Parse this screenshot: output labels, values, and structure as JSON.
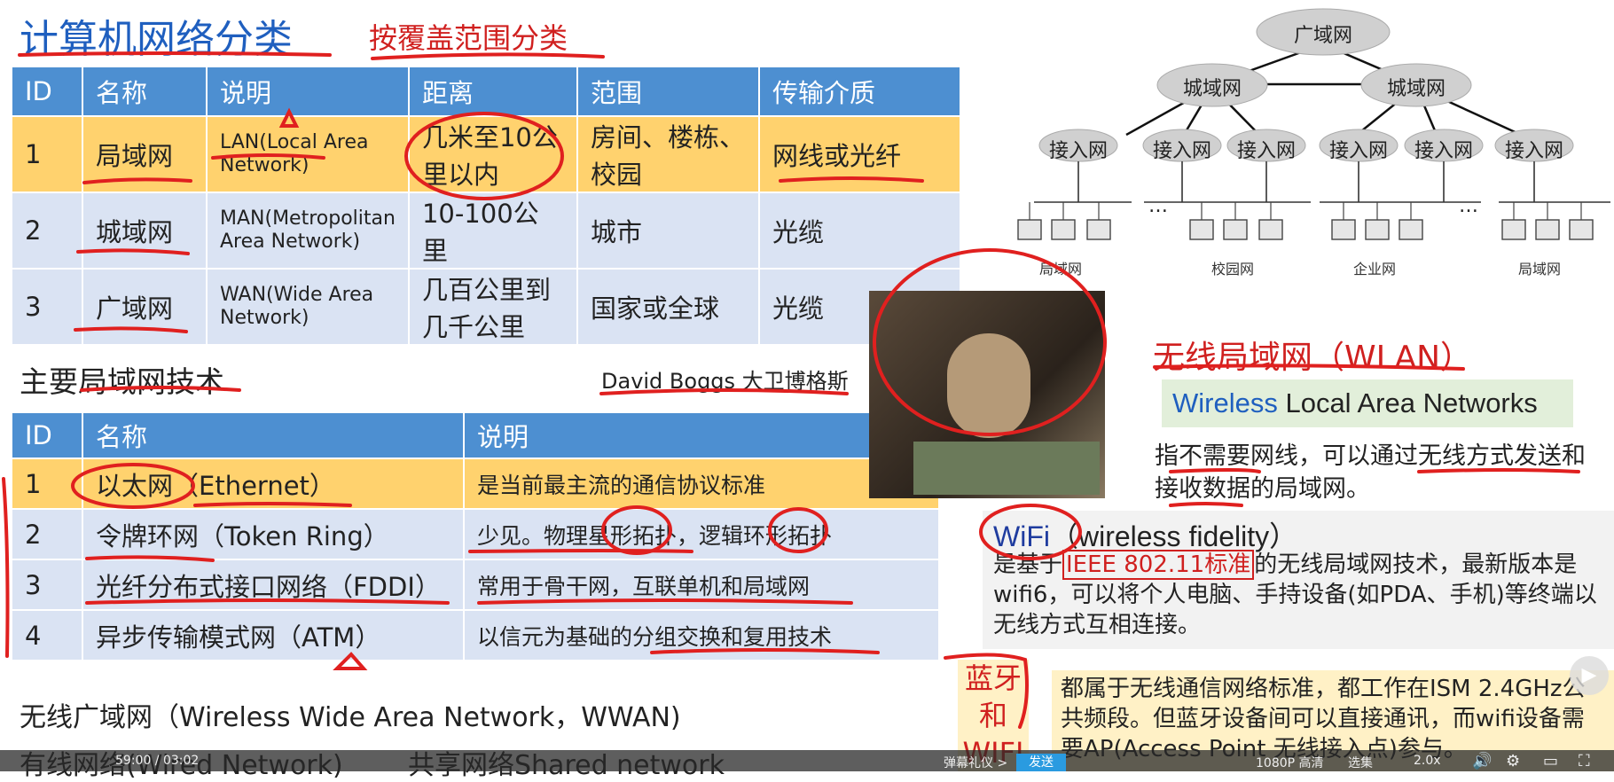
{
  "header": {
    "title": "计算机网络分类",
    "subtitle": "按覆盖范围分类"
  },
  "table1": {
    "headers": [
      "ID",
      "名称",
      "说明",
      "距离",
      "范围",
      "传输介质"
    ],
    "rows": [
      {
        "id": "1",
        "name": "局域网",
        "desc": "LAN(Local Area Network)",
        "distance": "几米至10公里以内",
        "scope": "房间、楼栋、校园",
        "media": "网线或光纤"
      },
      {
        "id": "2",
        "name": "城域网",
        "desc": "MAN(Metropolitan Area Network)",
        "distance": "10-100公里",
        "scope": "城市",
        "media": "光缆"
      },
      {
        "id": "3",
        "name": "广域网",
        "desc": "WAN(Wide Area Network)",
        "distance": "几百公里到几千公里",
        "scope": "国家或全球",
        "media": "光缆"
      }
    ]
  },
  "section2": {
    "title": "主要局域网技术",
    "caption": "David Boggs 大卫博格斯"
  },
  "table2": {
    "headers": [
      "ID",
      "名称",
      "说明"
    ],
    "rows": [
      {
        "id": "1",
        "name": "以太网（Ethernet）",
        "desc": "是当前最主流的通信协议标准"
      },
      {
        "id": "2",
        "name": "令牌环网（Token Ring）",
        "desc": "少见。物理星形拓扑，逻辑环形拓扑"
      },
      {
        "id": "3",
        "name": "光纤分布式接口网络（FDDI）",
        "desc": "常用于骨干网，互联单机和局域网"
      },
      {
        "id": "4",
        "name": "异步传输模式网（ATM）",
        "desc": "以信元为基础的分组交换和复用技术"
      }
    ]
  },
  "bottom": {
    "wwan": "无线广域网（Wireless Wide Area Network，WWAN)",
    "wired": "有线网络(Wired Network)",
    "shared": "共享网络Shared network"
  },
  "diagram": {
    "wan": "广域网",
    "man": [
      "城域网",
      "城域网"
    ],
    "access": [
      "接入网",
      "接入网",
      "接入网",
      "接入网",
      "接入网",
      "接入网"
    ],
    "dots": [
      "…",
      "…"
    ],
    "lans": [
      "局域网",
      "校园网",
      "企业网",
      "局域网"
    ]
  },
  "wlan": {
    "title": "无线局域网（WLAN）",
    "term_colored": "Wireless",
    "term_rest": " Local Area Networks",
    "desc": "指不需要网线，可以通过无线方式发送和接收数据的局域网。"
  },
  "wifi": {
    "name": "WiFi",
    "full": "（wireless fidelity）",
    "desc_pre": "是基于",
    "ieee": "IEEE 802.11标准",
    "desc_post": "的无线局域网技术，最新版本是wifi6，可以将个人电脑、手持设备(如PDA、手机)等终端以无线方式互相连接。"
  },
  "bluetooth": {
    "label": "蓝牙和WIFI",
    "desc": "都属于无线通信网络标准，都工作在ISM 2.4GHz公共频段。但蓝牙设备间可以直接通讯，而wifi设备需要AP(Access Point 无线接入点)参与。"
  },
  "player": {
    "time": "59:00 / 03:02",
    "danmaku": "弹幕礼仪 >",
    "send": "发送",
    "quality": "1080P 高清",
    "select": "选集",
    "speed": "2.0x"
  },
  "colors": {
    "header_blue": "#4d8fd1",
    "highlight": "#ffd26e",
    "row_light": "#dae3f3",
    "annotation_red": "#e0201f",
    "title_blue": "#1f5fbf"
  }
}
